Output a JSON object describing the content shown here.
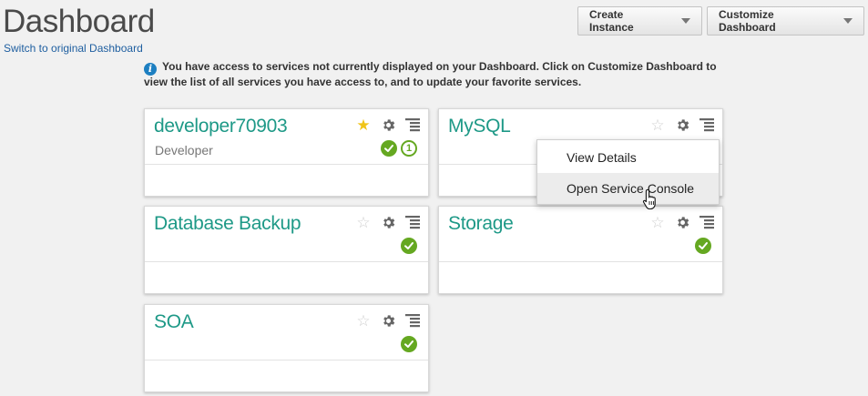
{
  "header": {
    "title": "Dashboard",
    "switch_link": "Switch to original Dashboard",
    "create_instance": "Create Instance",
    "customize_dashboard": "Customize Dashboard"
  },
  "info": {
    "message": "You have access to services not currently displayed on your Dashboard. Click on Customize Dashboard to view the list of all services you have access to, and to update your favorite services."
  },
  "tiles": [
    {
      "name": "developer70903",
      "subtitle": "Developer",
      "favorite": true,
      "status": "ok",
      "badge": "1"
    },
    {
      "name": "MySQL",
      "favorite": false
    },
    {
      "name": "Database Backup",
      "favorite": false,
      "status": "ok"
    },
    {
      "name": "Storage",
      "favorite": false,
      "status": "ok"
    },
    {
      "name": "SOA",
      "favorite": false,
      "status": "ok"
    }
  ],
  "context_menu": {
    "items": [
      "View Details",
      "Open Service Console"
    ],
    "hovered": "Open Service Console"
  },
  "colors": {
    "service_name": "#1e9987",
    "status_ok": "#65a821",
    "favorite_star": "#f0c419",
    "link": "#1f5fa0",
    "info_icon": "#1d7fc1"
  },
  "icons": {
    "favorite": "star-icon",
    "settings": "gear-icon",
    "menu": "list-menu-icon",
    "status": "checkmark-circle-icon",
    "info": "info-icon"
  }
}
